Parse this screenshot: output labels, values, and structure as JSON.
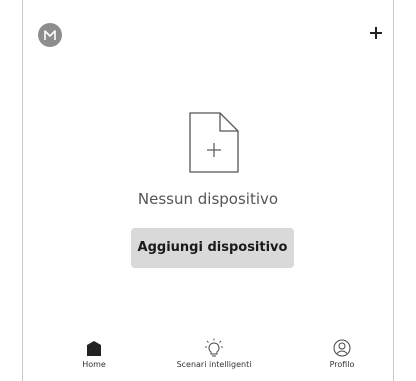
{
  "app": {
    "avatar_letter": "M",
    "empty_state": {
      "message": "Nessun dispositivo",
      "action_label": "Aggiungi dispositivo"
    },
    "bottom_nav": [
      {
        "label": "Home",
        "icon": "home-icon",
        "active": true
      },
      {
        "label": "Scenari intelligenti",
        "icon": "lightbulb-icon",
        "active": false
      },
      {
        "label": "Profilo",
        "icon": "profile-icon",
        "active": false
      }
    ],
    "colors": {
      "avatar_bg": "#8d8d8d",
      "cta_bg": "#d9d9d9"
    }
  }
}
